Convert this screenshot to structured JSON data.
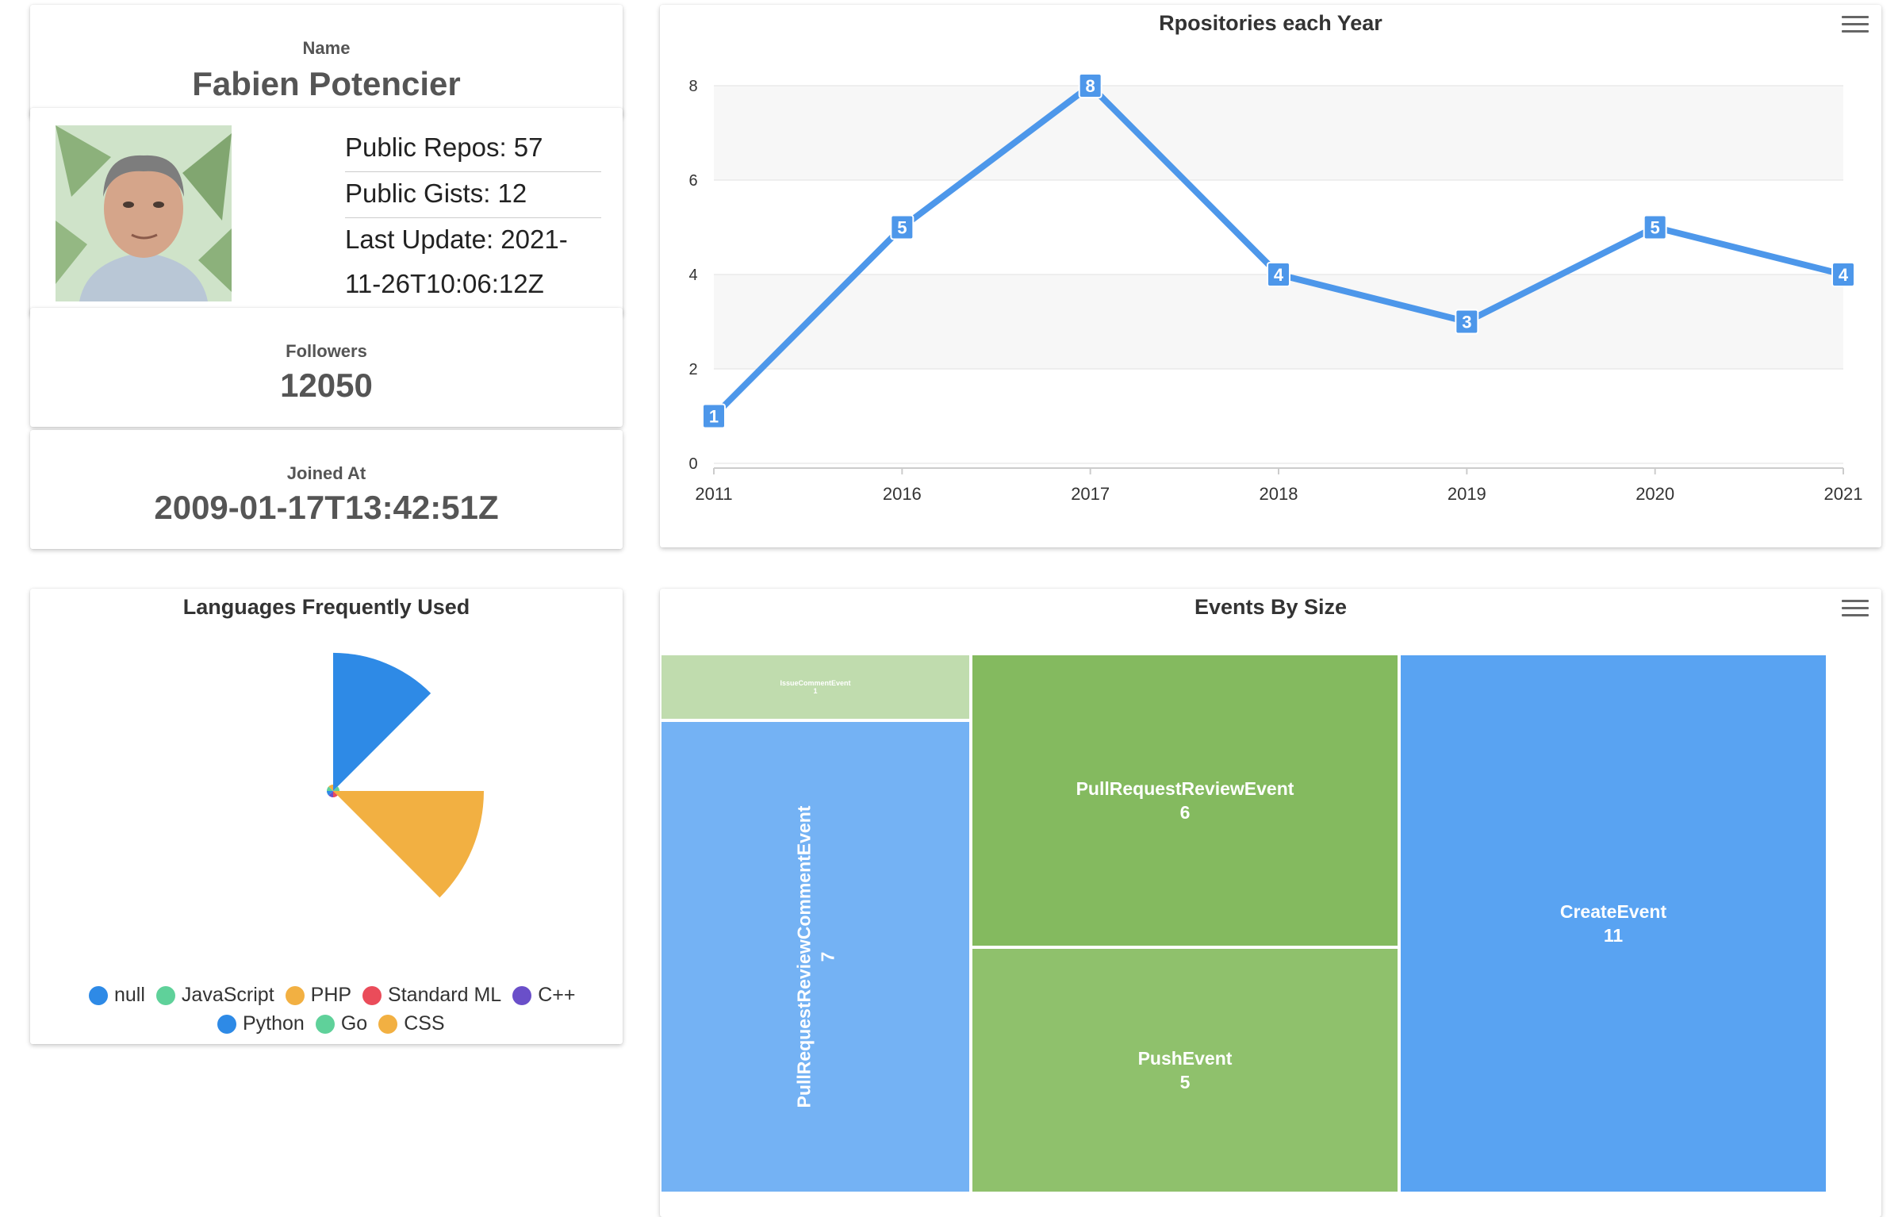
{
  "profile": {
    "name_label": "Name",
    "name": "Fabien Potencier",
    "public_repos": "Public Repos: 57",
    "public_gists": "Public Gists: 12",
    "last_update_1": "Last Update: 2021-",
    "last_update_2": "11-26T10:06:12Z",
    "followers_label": "Followers",
    "followers": "12050",
    "joined_label": "Joined At",
    "joined": "2009-01-17T13:42:51Z"
  },
  "colors": {
    "blue": "#2e8ae6",
    "line_blue": "#4d97ea",
    "orange": "#f2b042",
    "green": "#8cc06b",
    "red": "#ea4c5a",
    "purple": "#6a4fc9",
    "teal": "#5fd19a"
  },
  "repos_chart": {
    "title": "Rpositories each Year",
    "menu_icon": "hamburger-menu-icon",
    "chart_data": {
      "type": "line",
      "title": "Rpositories each Year",
      "x": [
        "2011",
        "2016",
        "2017",
        "2018",
        "2019",
        "2020",
        "2021"
      ],
      "series": [
        {
          "values": [
            1,
            5,
            8,
            4,
            3,
            5,
            4
          ]
        }
      ],
      "yticks": [
        "0",
        "2",
        "4",
        "6",
        "8"
      ],
      "ylim": [
        0,
        8
      ],
      "grid": true
    }
  },
  "languages_chart": {
    "title": "Languages Frequently Used",
    "chart_data": {
      "type": "pie",
      "subtype": "polar-area",
      "title": "Languages Frequently Used",
      "legend_placement": "bottom",
      "legend": [
        {
          "name": "null",
          "color": "#2e8ae6"
        },
        {
          "name": "JavaScript",
          "color": "#5fd19a"
        },
        {
          "name": "PHP",
          "color": "#f2b042"
        },
        {
          "name": "Standard ML",
          "color": "#ea4c5a"
        },
        {
          "name": "C++",
          "color": "#6a4fc9"
        },
        {
          "name": "Python",
          "color": "#2e8ae6"
        },
        {
          "name": "Go",
          "color": "#5fd19a"
        },
        {
          "name": "CSS",
          "color": "#f2b042"
        }
      ],
      "values": [
        22,
        1,
        24,
        1,
        1,
        1,
        1,
        1
      ]
    }
  },
  "events_chart": {
    "title": "Events By Size",
    "menu_icon": "hamburger-menu-icon",
    "chart_data": {
      "type": "treemap",
      "title": "Events By Size",
      "items": [
        {
          "name": "IssueCommentEvent",
          "value": 1
        },
        {
          "name": "PullRequestReviewCommentEvent",
          "value": 7
        },
        {
          "name": "PullRequestReviewEvent",
          "value": 6
        },
        {
          "name": "PushEvent",
          "value": 5
        },
        {
          "name": "CreateEvent",
          "value": 11
        }
      ]
    }
  }
}
